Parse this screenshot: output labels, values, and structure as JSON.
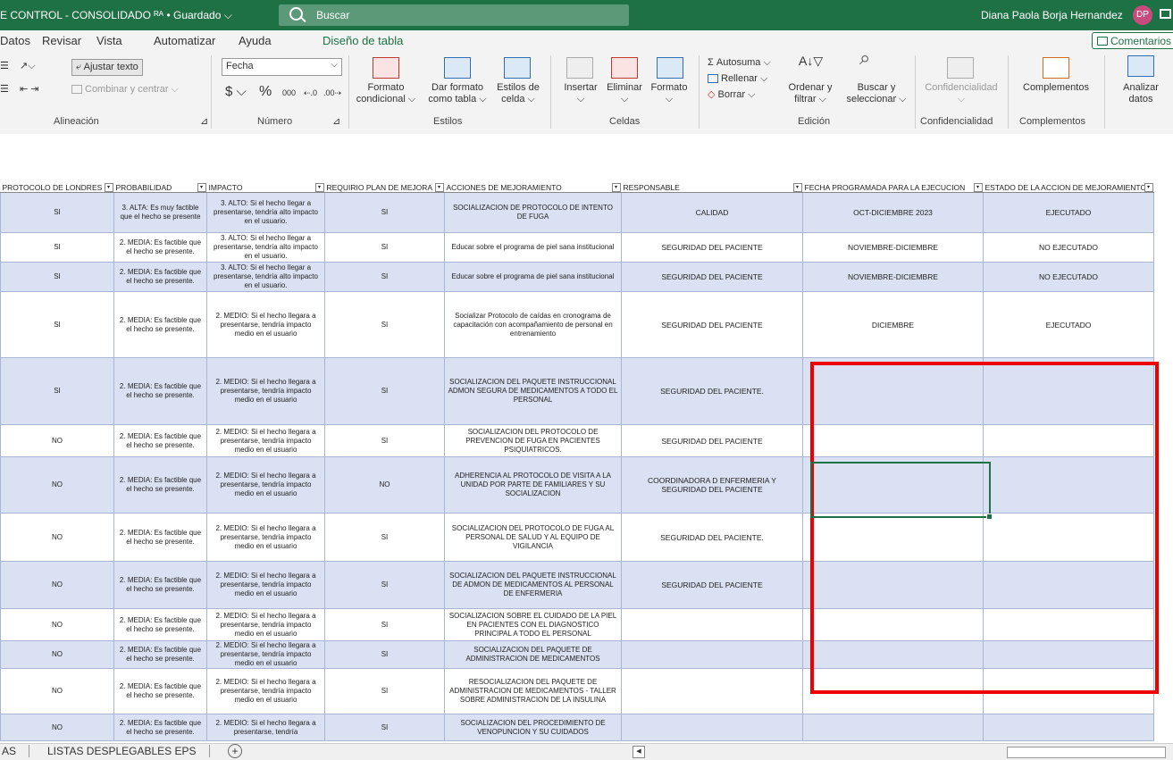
{
  "titlebar": {
    "title": "E CONTROL - CONSOLIDADO",
    "saved_status": "Guardado",
    "search_placeholder": "Buscar",
    "user_name": "Diana Paola Borja Hernandez",
    "user_initials": "DP"
  },
  "tabs": [
    "Datos",
    "Revisar",
    "Vista",
    "Automatizar",
    "Ayuda",
    "Diseño de tabla"
  ],
  "active_tab": "Diseño de tabla",
  "comment_button": "Comentarios",
  "ribbon": {
    "alineacion": {
      "wrap_text": "Ajustar texto",
      "merge_center": "Combinar y centrar",
      "group_label": "Alineación"
    },
    "numero": {
      "format_value": "Fecha",
      "currency": "$",
      "percent": "%",
      "thousands": "000",
      "group_label": "Número"
    },
    "estilos": {
      "cond_format_1": "Formato",
      "cond_format_2": "condicional",
      "format_table_1": "Dar formato",
      "format_table_2": "como tabla",
      "cell_styles_1": "Estilos de",
      "cell_styles_2": "celda",
      "group_label": "Estilos"
    },
    "celdas": {
      "insert": "Insertar",
      "delete": "Eliminar",
      "format": "Formato",
      "group_label": "Celdas"
    },
    "edicion": {
      "autosum": "Autosuma",
      "fill": "Rellenar",
      "clear": "Borrar",
      "sort_1": "Ordenar y",
      "sort_2": "filtrar",
      "find_1": "Buscar y",
      "find_2": "seleccionar",
      "group_label": "Edición"
    },
    "confidencialidad": {
      "button": "Confidencialidad",
      "group_label": "Confidencialidad"
    },
    "complementos": {
      "button": "Complementos",
      "group_label": "Complementos"
    },
    "analizar": {
      "line1": "Analizar",
      "line2": "datos"
    }
  },
  "headers": [
    "PROTOCOLO DE LONDRES",
    "PROBABILIDAD",
    "IMPACTO",
    "REQUIRIO PLAN DE MEJORA",
    "ACCIONES DE MEJORAMIENTO",
    "RESPONSABLE",
    "FECHA PROGRAMADA PARA LA EJECUCION",
    "ESTADO DE LA ACCION DE MEJORAMIENTO"
  ],
  "rows": [
    [
      "SI",
      "3. ALTA: Es muy factible que el hecho se presente",
      "3. ALTO: Si el hecho llegar a presentarse, tendría alto impacto en el usuario.",
      "SI",
      "SOCIALIZACION DE PROTOCOLO DE INTENTO DE FUGA",
      "CALIDAD",
      "OCT-DICIEMBRE 2023",
      "EJECUTADO"
    ],
    [
      "SI",
      "2. MEDIA: Es factible que el hecho se presente.",
      "3. ALTO: Si el hecho llegar a presentarse, tendría alto impacto en el usuario.",
      "SI",
      "Educar sobre el programa de piel sana institucional",
      "SEGURIDAD DEL PACIENTE",
      "NOVIEMBRE-DICIEMBRE",
      "NO EJECUTADO"
    ],
    [
      "SI",
      "2. MEDIA: Es factible que el hecho se presente.",
      "3. ALTO: Si el hecho llegar a presentarse, tendría alto impacto en el usuario.",
      "SI",
      "Educar sobre el programa de piel sana institucional",
      "SEGURIDAD DEL PACIENTE",
      "NOVIEMBRE-DICIEMBRE",
      "NO EJECUTADO"
    ],
    [
      "SI",
      "2. MEDIA: Es factible que el hecho se presente.",
      "2. MEDIO: Si el hecho llegara a presentarse, tendría impacto medio en el usuario",
      "SI",
      "Socializar Protocolo de caídas en cronograma de capacitación con acompañamiento de personal en entrenamiento",
      "SEGURIDAD DEL PACIENTE",
      "DICIEMBRE",
      "EJECUTADO"
    ],
    [
      "SI",
      "2. MEDIA: Es factible que el hecho se presente.",
      "2. MEDIO: Si el hecho llegara a presentarse, tendría impacto medio en el usuario",
      "SI",
      "SOCIALIZACION DEL PAQUETE INSTRUCCIONAL ADMON SEGURA DE MEDICAMENTOS A TODO EL PERSONAL",
      "SEGURIDAD DEL PACIENTE.",
      "",
      ""
    ],
    [
      "NO",
      "2. MEDIA: Es factible que el hecho se presente.",
      "2. MEDIO: Si el hecho llegara a presentarse, tendría impacto medio en el usuario",
      "SI",
      "SOCIALIZACION DEL PROTOCOLO DE PREVENCION DE FUGA EN PACIENTES PSIQUIATRICOS.",
      "SEGURIDAD DEL PACIENTE",
      "",
      ""
    ],
    [
      "NO",
      "2. MEDIA: Es factible que el hecho se presente.",
      "2. MEDIO: Si el hecho llegara a presentarse, tendría impacto medio en el usuario",
      "NO",
      "ADHERENCIA AL PROTOCOLO DE VISITA A LA UNIDAD POR PARTE DE FAMILIARES Y SU SOCIALIZACION",
      "COORDINADORA D ENFERMERIA Y SEGURIDAD DEL PACIENTE",
      "",
      ""
    ],
    [
      "NO",
      "2. MEDIA: Es factible que el hecho se presente.",
      "2. MEDIO: Si el hecho llegara a presentarse, tendría impacto medio en el usuario",
      "SI",
      "SOCIALIZACION DEL PROTOCOLO DE FUGA AL PERSONAL DE SALUD Y AL EQUIPO DE VIGILANCIA",
      "SEGURIDAD DEL PACIENTE.",
      "",
      ""
    ],
    [
      "NO",
      "2. MEDIA: Es factible que el hecho se presente.",
      "2. MEDIO: Si el hecho llegara a presentarse, tendría impacto medio en el usuario",
      "SI",
      "SOCIALIZACION DEL PAQUETE INSTRUCCIONAL DE ADMON DE MEDICAMENTOS AL PERSONAL DE ENFERMERIA",
      "SEGURIDAD DEL PACIENTE",
      "",
      ""
    ],
    [
      "NO",
      "2. MEDIA: Es factible que el hecho se presente.",
      "2. MEDIO: Si el hecho llegara a presentarse, tendría impacto medio en el usuario",
      "SI",
      "SOCIALIZACION SOBRE EL CUIDADO DE LA PIEL EN PACIENTES CON EL DIAGNOSTICO PRINCIPAL A TODO EL PERSONAL",
      "",
      "",
      ""
    ],
    [
      "NO",
      "2. MEDIA: Es factible que el hecho se presente.",
      "2. MEDIO: Si el hecho llegara a presentarse, tendría impacto medio en el usuario",
      "SI",
      "SOCIALIZACION DEL PAQUETE DE ADMINISTRACION DE MEDICAMENTOS",
      "",
      "",
      ""
    ],
    [
      "NO",
      "2. MEDIA: Es factible que el hecho se presente.",
      "2. MEDIO: Si el hecho llegara a presentarse, tendría impacto medio en el usuario",
      "SI",
      "RESOCIALIZACION DEL PAQUETE DE ADMINISTRACION DE MEDICAMENTOS - TALLER SOBRE ADMINISTRACION DE LA INSULINA",
      "",
      "",
      ""
    ],
    [
      "NO",
      "2. MEDIA: Es factible que el hecho se presente.",
      "2. MEDIO: Si el hecho llegara a presentarse, tendría",
      "SI",
      "SOCIALIZACION DEL PROCEDIMIENTO DE VENOPUNCION Y SU CUIDADOS",
      "",
      "",
      ""
    ]
  ],
  "sheet_tabs": [
    "AS",
    "LISTAS DESPLEGABLES EPS"
  ],
  "colors": {
    "excel_green": "#1e7145",
    "band_blue": "#d9e1f2",
    "highlight_red": "#e00000"
  }
}
